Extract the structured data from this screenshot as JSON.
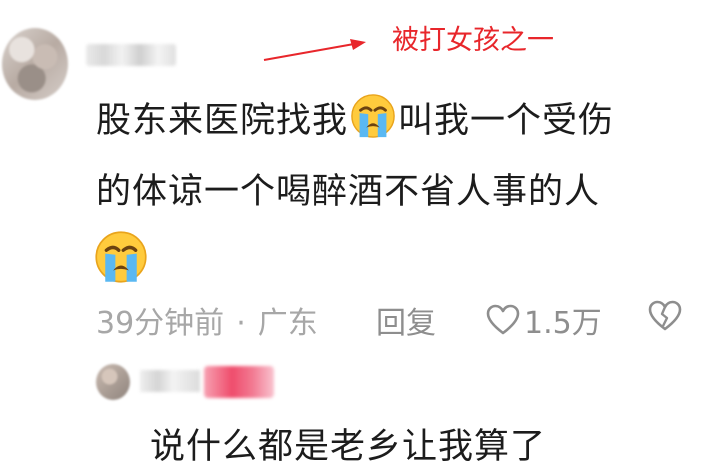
{
  "annotation": {
    "text": "被打女孩之一",
    "color": "#e8262b"
  },
  "comment": {
    "segments": [
      "股东来医院找我",
      "叫我一个受伤",
      "的体谅一个喝醉酒不省人事的人"
    ],
    "emoji": "loudly-crying-face",
    "time": "39分钟前",
    "location": "广东",
    "reply_label": "回复",
    "like_count": "1.5万"
  },
  "reply": {
    "text": "说什么都是老乡让我算了"
  }
}
